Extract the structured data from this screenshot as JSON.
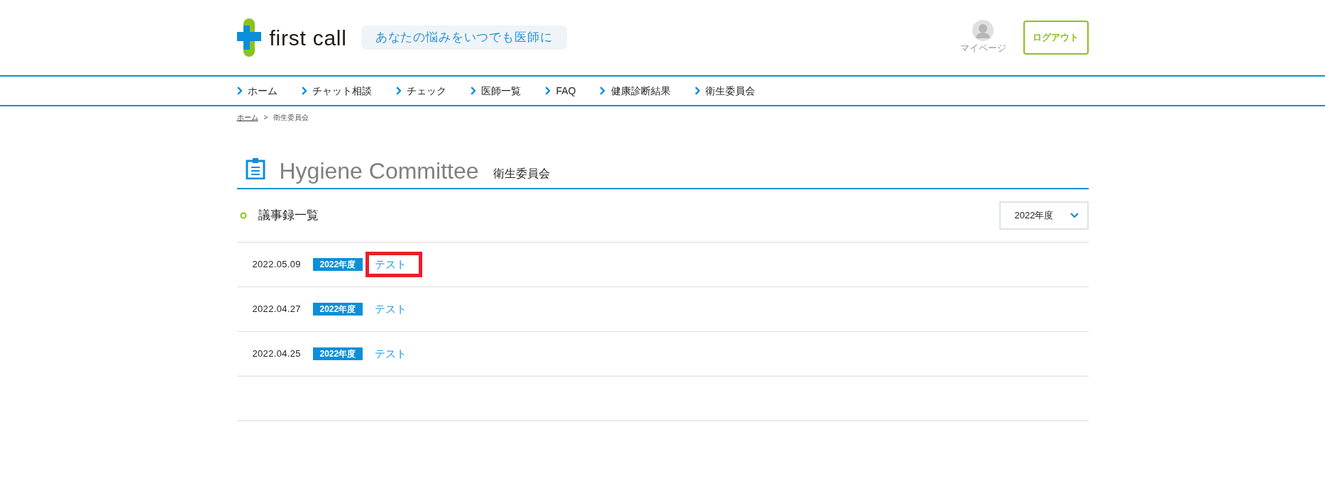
{
  "header": {
    "logo_text": "first call",
    "tagline": "あなたの悩みをいつでも医師に",
    "mypage": "マイページ",
    "logout": "ログアウト"
  },
  "nav": [
    {
      "label": "ホーム"
    },
    {
      "label": "チャット相談"
    },
    {
      "label": "チェック"
    },
    {
      "label": "医師一覧"
    },
    {
      "label": "FAQ"
    },
    {
      "label": "健康診断結果"
    },
    {
      "label": "衛生委員会"
    }
  ],
  "breadcrumb": [
    {
      "label": "ホーム",
      "kind": "link"
    },
    {
      "label": ">",
      "kind": "sep"
    },
    {
      "label": "衛生委員会",
      "kind": "current"
    }
  ],
  "page_title": {
    "en": "Hygiene Committee",
    "ja": "衛生委員会"
  },
  "section": {
    "title": "議事録一覧",
    "year_select": "2022年度"
  },
  "rows": [
    {
      "date": "2022.05.09",
      "tag": "2022年度",
      "title": "テスト",
      "highlighted": true
    },
    {
      "date": "2022.04.27",
      "tag": "2022年度",
      "title": "テスト",
      "highlighted": false
    },
    {
      "date": "2022.04.25",
      "tag": "2022年度",
      "title": "テスト",
      "highlighted": false
    }
  ]
}
